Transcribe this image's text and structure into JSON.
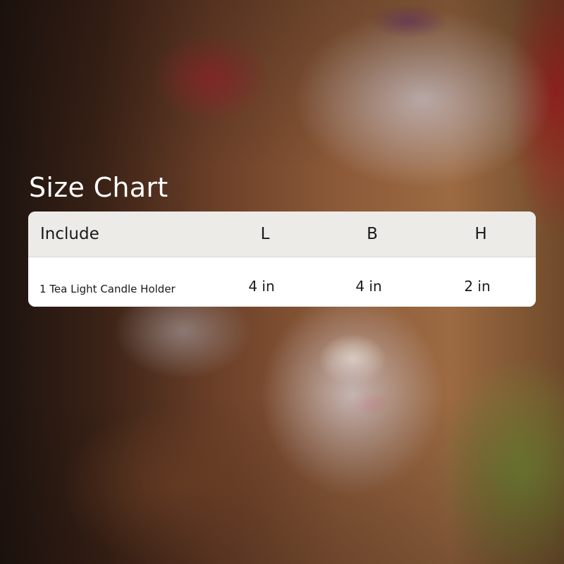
{
  "title": "Size Chart",
  "table": {
    "headers": {
      "include": "Include",
      "l": "L",
      "b": "B",
      "h": "H"
    },
    "rows": [
      {
        "include": "1 Tea Light Candle Holder",
        "l": "4 in",
        "b": "4 in",
        "h": "2 in"
      }
    ]
  }
}
